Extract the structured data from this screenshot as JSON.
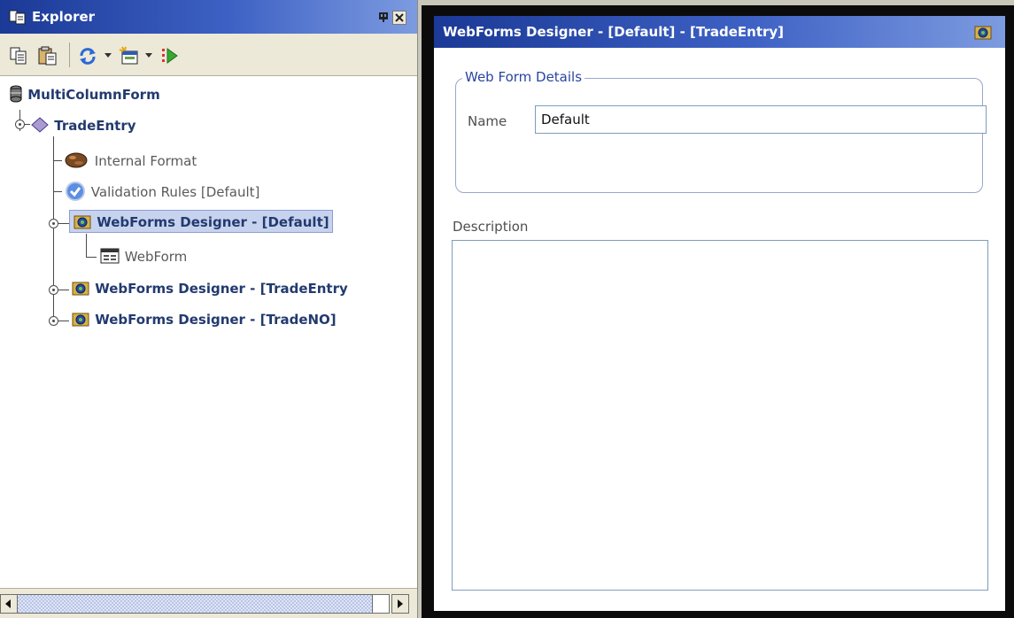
{
  "explorer": {
    "title": "Explorer",
    "tree": {
      "root": "MultiColumnForm",
      "child": "TradeEntry",
      "items": {
        "internal_format": "Internal Format",
        "validation_rules": "Validation Rules [Default]",
        "designer_default": "WebForms Designer - [Default]",
        "webform": "WebForm",
        "designer_tradeentry": "WebForms Designer - [TradeEntry",
        "designer_tradeno": "WebForms Designer - [TradeNO]"
      },
      "selected": "WebForms Designer - [Default]"
    },
    "toolbar_icons": [
      "copy-icon",
      "paste-icon",
      "refresh-icon",
      "new-webform-icon",
      "run-icon"
    ]
  },
  "designer": {
    "title": "WebForms Designer - [Default] -  [TradeEntry]",
    "group_legend": "Web Form Details",
    "name_label": "Name",
    "name_value": "Default",
    "description_label": "Description",
    "description_value": ""
  },
  "colors": {
    "title_gradient_start": "#1b3996",
    "title_gradient_end": "#7d9be0",
    "tree_bold_text": "#233a6f",
    "selection_bg": "#c7d3ee",
    "legend_text": "#2a45a0"
  }
}
